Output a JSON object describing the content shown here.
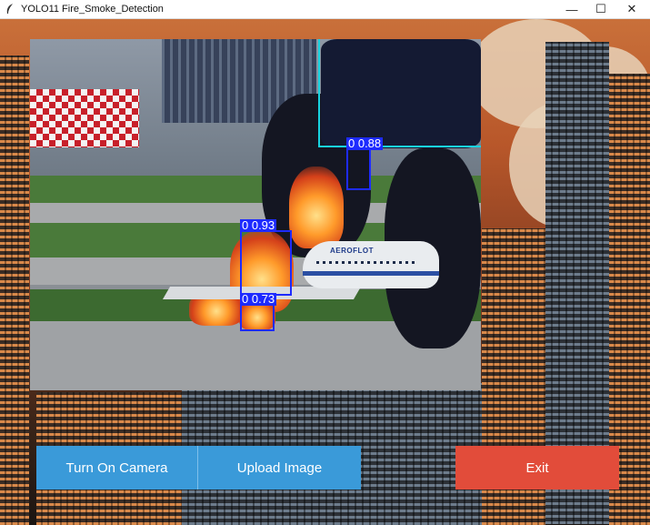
{
  "window": {
    "title": "YOLO11 Fire_Smoke_Detection",
    "controls": [
      "minimize-icon",
      "maximize-icon",
      "close-icon"
    ],
    "minimize_glyph": "—",
    "maximize_glyph": "☐",
    "close_glyph": "✕"
  },
  "image": {
    "plane_logo": "AEROFLOT",
    "detections": [
      {
        "label": "0 0.88"
      },
      {
        "label": "0 0.93"
      },
      {
        "label": "0 0.73"
      }
    ],
    "box_color": "#1e2bff",
    "region_color": "#18d3e0"
  },
  "buttons": {
    "camera": "Turn On Camera",
    "upload": "Upload Image",
    "exit": "Exit"
  },
  "colors": {
    "primary_button": "#3a9ad9",
    "exit_button": "#e24c3a"
  }
}
